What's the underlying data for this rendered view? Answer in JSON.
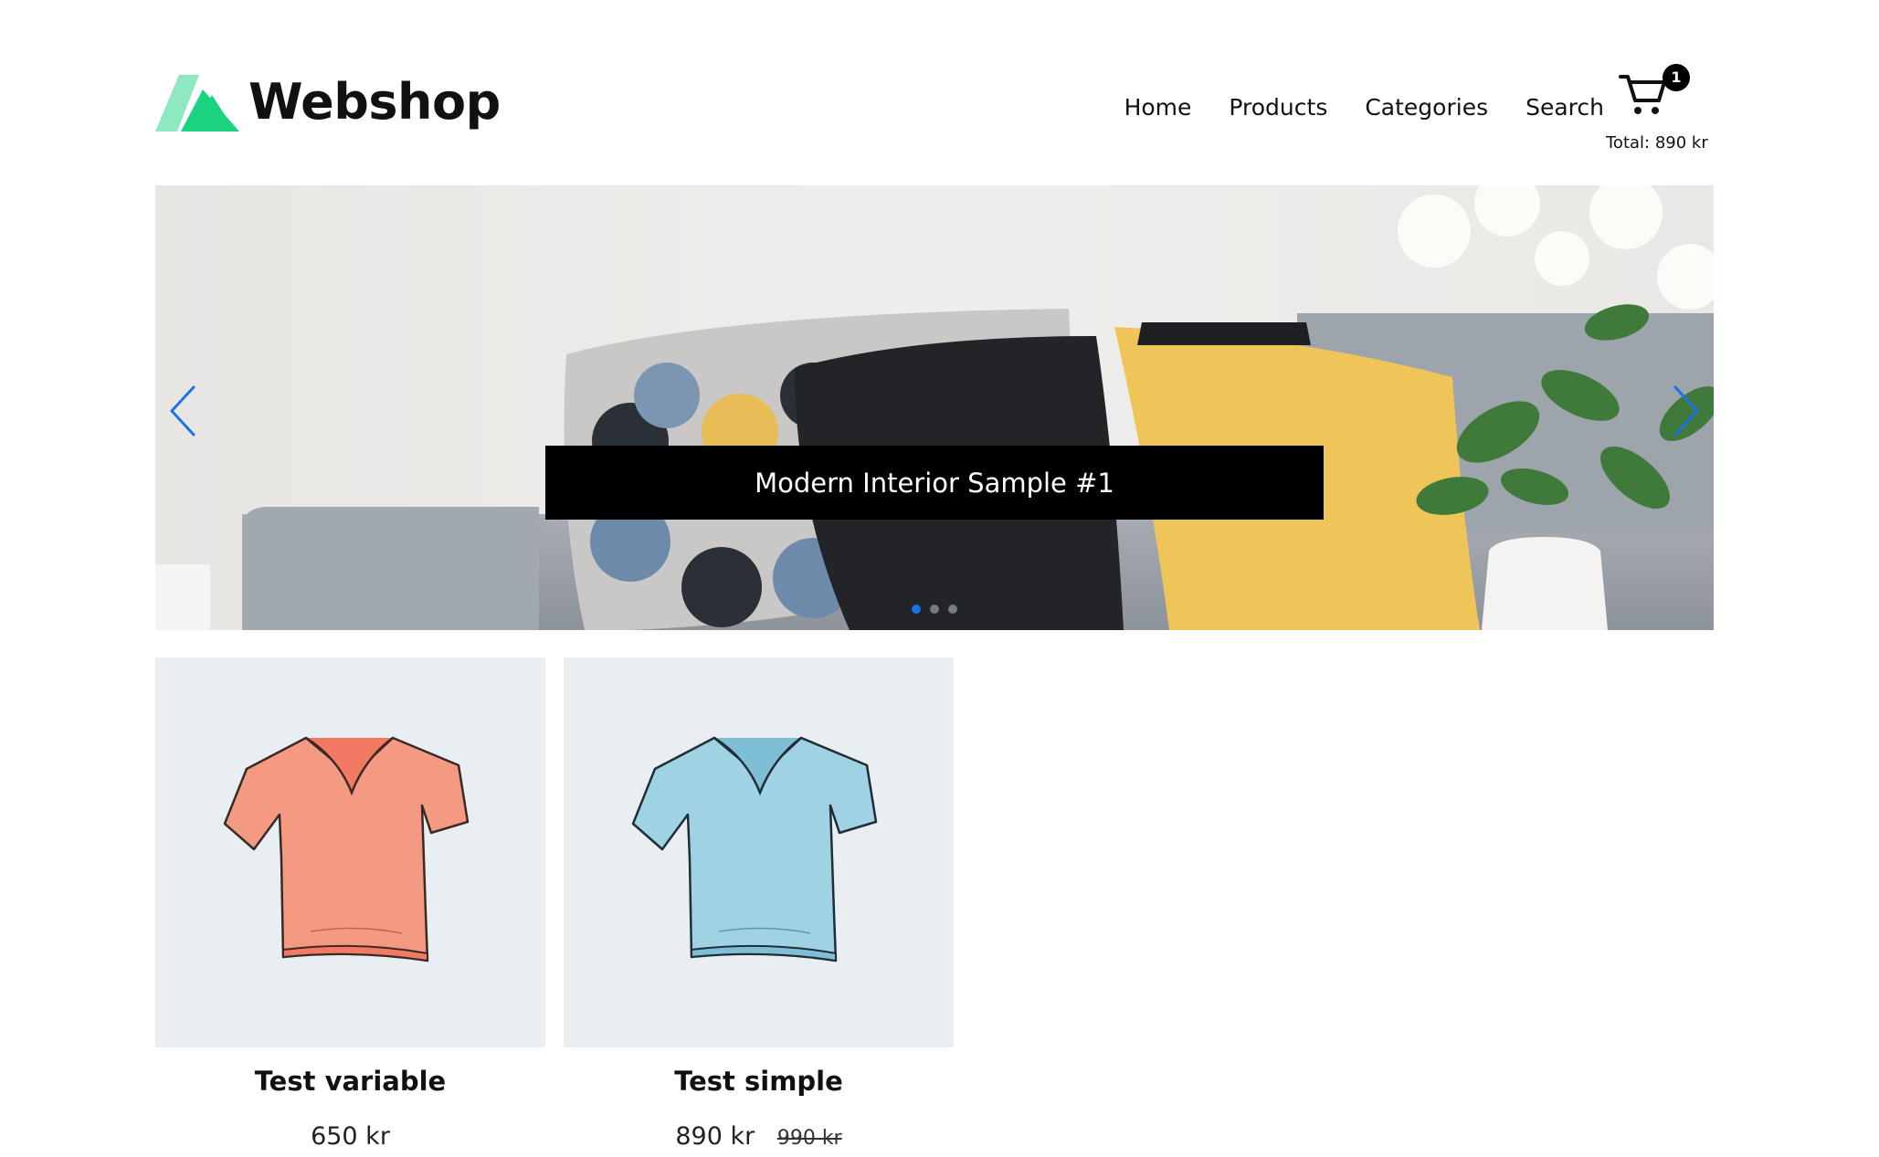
{
  "brand": {
    "name": "Webshop",
    "logo_icon": "webshop-logo-icon",
    "logo_colors": [
      "#8ee8c0",
      "#19d37f"
    ]
  },
  "nav": {
    "items": [
      {
        "label": "Home"
      },
      {
        "label": "Products"
      },
      {
        "label": "Categories"
      },
      {
        "label": "Search"
      }
    ]
  },
  "cart": {
    "icon": "cart-icon",
    "count": "1",
    "total": "Total: 890 kr"
  },
  "carousel": {
    "caption": "Modern Interior Sample #1",
    "slide_count": 3,
    "active_slide": 1,
    "arrow_color": "#1a73e8"
  },
  "products": [
    {
      "name": "Test variable",
      "price": "650 kr",
      "old_price": "",
      "image": "orange-tshirt-image",
      "shirt_color": "#f59a82"
    },
    {
      "name": "Test simple",
      "price": "890 kr",
      "old_price": "990 kr",
      "image": "blue-tshirt-image",
      "shirt_color": "#9fd2e3"
    }
  ]
}
